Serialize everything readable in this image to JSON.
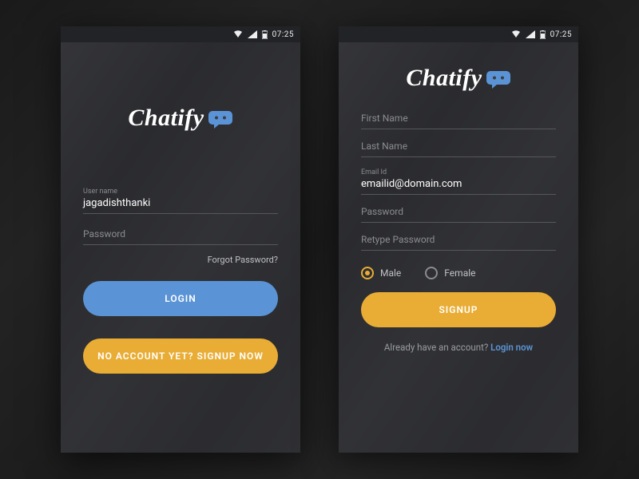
{
  "brand": {
    "name": "Chatify"
  },
  "statusbar": {
    "time": "07:25"
  },
  "login": {
    "username_label": "User name",
    "username_value": "jagadishthanki",
    "password_placeholder": "Password",
    "forgot": "Forgot Password?",
    "login_button": "LOGIN",
    "signup_button": "NO ACCOUNT YET? SIGNUP NOW"
  },
  "signup": {
    "first_name_placeholder": "First Name",
    "last_name_placeholder": "Last Name",
    "email_label": "Email Id",
    "email_value": "emailid@domain.com",
    "password_placeholder": "Password",
    "retype_placeholder": "Retype Password",
    "gender": {
      "male": "Male",
      "female": "Female",
      "selected": "male"
    },
    "signup_button": "SIGNUP",
    "already_text": "Already have an account? ",
    "login_link": "Login now"
  },
  "colors": {
    "blue": "#5b94d6",
    "yellow": "#e9ad36"
  }
}
